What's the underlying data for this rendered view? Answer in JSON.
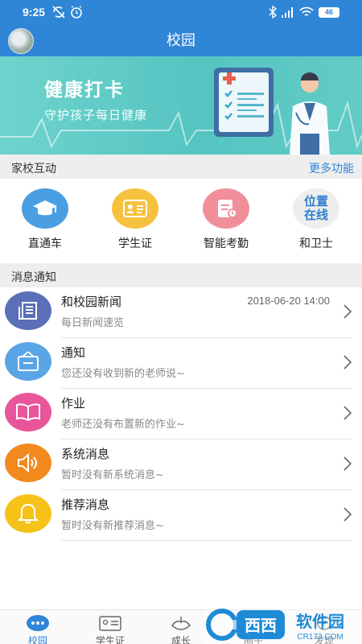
{
  "status_bar": {
    "time": "9:25",
    "battery": "46"
  },
  "header": {
    "title": "校园"
  },
  "banner": {
    "title": "健康打卡",
    "subtitle": "守护孩子每日健康"
  },
  "section_interaction": {
    "label": "家校互动",
    "more": "更多功能"
  },
  "quick_items": [
    {
      "label": "直通车",
      "color": "#4a9fe3",
      "icon": "graduation-cap-icon"
    },
    {
      "label": "学生证",
      "color": "#f6c13e",
      "icon": "id-card-icon"
    },
    {
      "label": "智能考勤",
      "color": "#f08f9a",
      "icon": "attendance-icon"
    },
    {
      "label": "和卫士",
      "color": "#eeeeee",
      "icon": "location-online-icon",
      "icon_text_1": "位置",
      "icon_text_2": "在线"
    }
  ],
  "section_messages": {
    "label": "消息通知"
  },
  "messages": [
    {
      "title": "和校园新闻",
      "subtitle": "每日新闻速览",
      "date": "2018-06-20 14:00",
      "color": "#5a6fb8",
      "icon": "news-icon"
    },
    {
      "title": "通知",
      "subtitle": "您还没有收到新的老师说~",
      "date": "",
      "color": "#5aa5e6",
      "icon": "notice-board-icon"
    },
    {
      "title": "作业",
      "subtitle": "老师还没有布置新的作业~",
      "date": "",
      "color": "#e8559a",
      "icon": "book-icon"
    },
    {
      "title": "系统消息",
      "subtitle": "暂时没有新系统消息~",
      "date": "",
      "color": "#f28a1e",
      "icon": "speaker-icon"
    },
    {
      "title": "推荐消息",
      "subtitle": "暂时没有新推荐消息~",
      "date": "",
      "color": "#f6c21a",
      "icon": "bell-icon"
    }
  ],
  "tabs": [
    {
      "label": "校园",
      "active": true
    },
    {
      "label": "学生证",
      "active": false
    },
    {
      "label": "成长",
      "active": false
    },
    {
      "label": "圈子",
      "active": false
    },
    {
      "label": "发现",
      "active": false
    }
  ],
  "watermark": {
    "text": "西西软件园",
    "sub": "CR173.COM"
  },
  "colors": {
    "primary": "#2f85d6",
    "banner": "#5ac8c4"
  }
}
